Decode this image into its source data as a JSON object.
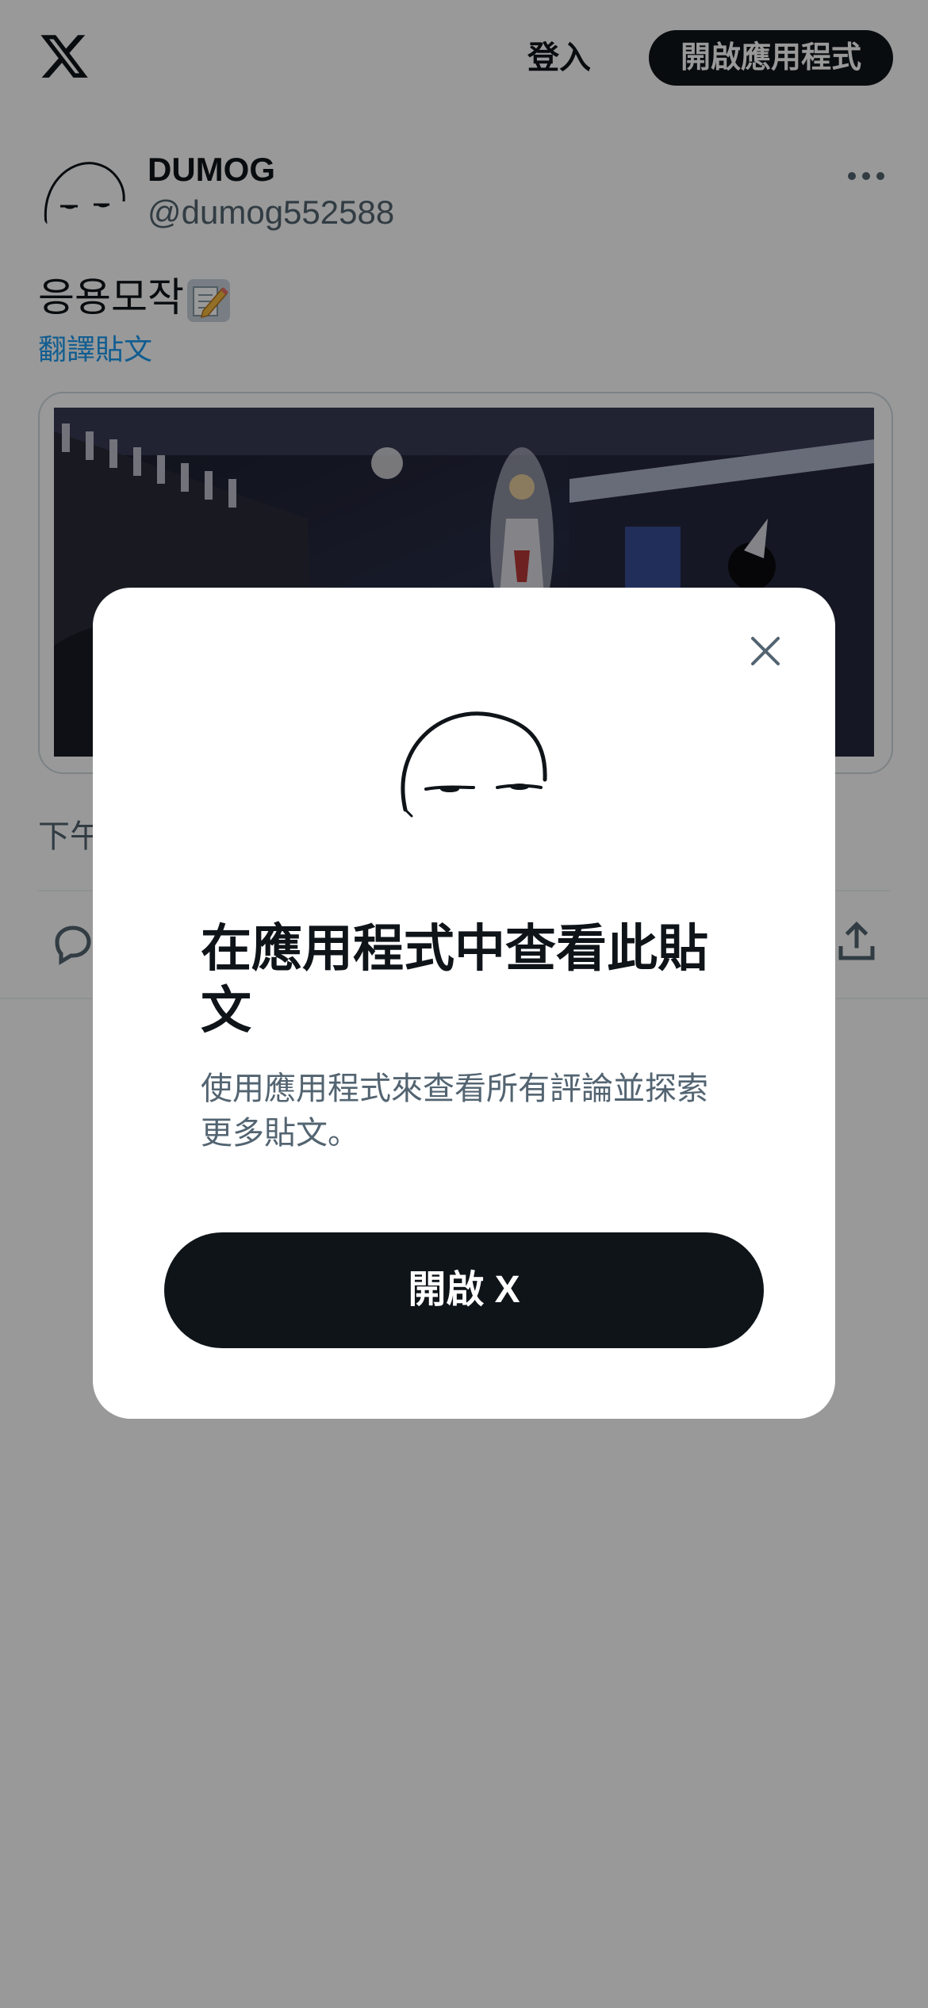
{
  "topbar": {
    "login_label": "登入",
    "open_app_label": "開啟應用程式"
  },
  "post": {
    "author_name": "DUMOG",
    "author_handle": "@dumog552588",
    "text": "응용모작",
    "emoji": "memo-emoji",
    "translate_label": "翻譯貼文",
    "timestamp_visible": "下午"
  },
  "modal": {
    "title": "在應用程式中查看此貼文",
    "subtitle": "使用應用程式來查看所有評論並探索更多貼文。",
    "open_button_label": "開啟 X"
  },
  "colors": {
    "primary_text": "#0f1419",
    "secondary_text": "#536471",
    "link": "#1d9bf0",
    "button_dark": "#0f1419",
    "overlay": "rgba(0,0,0,0.4)"
  }
}
